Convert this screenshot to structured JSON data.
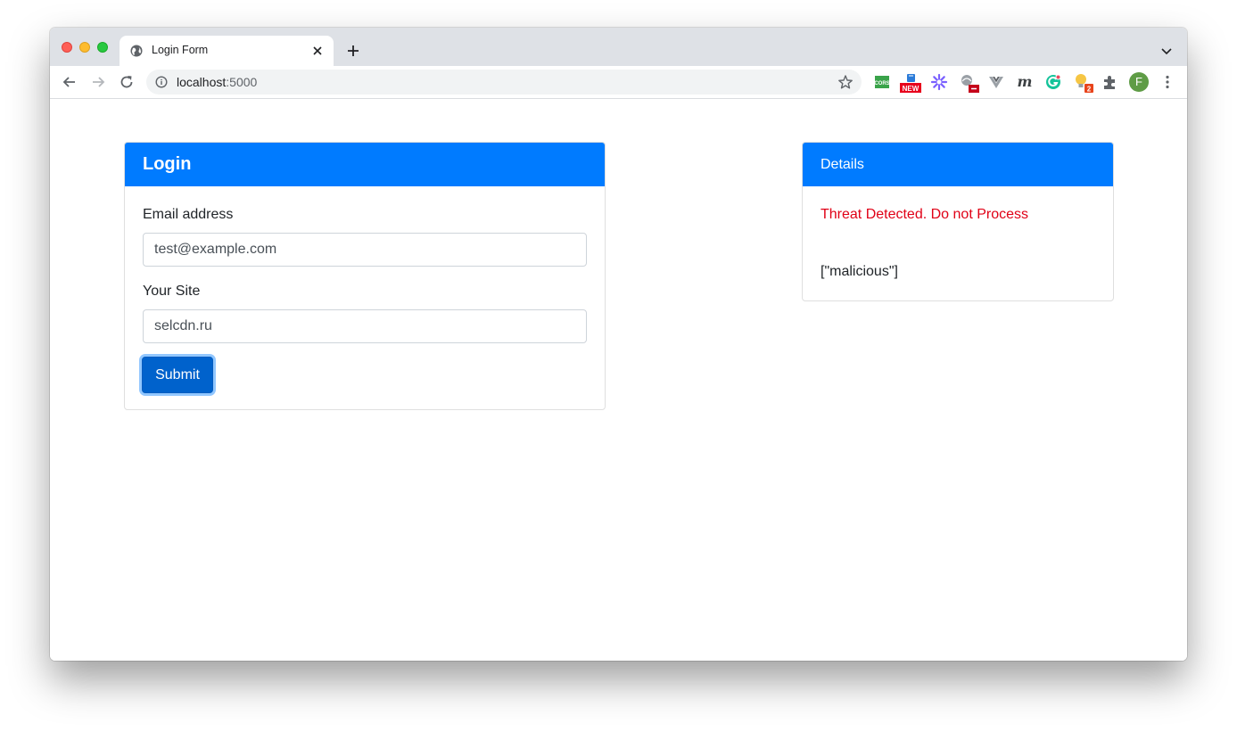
{
  "browser": {
    "tab_title": "Login Form",
    "url_host": "localhost",
    "url_port": ":5000",
    "extensions": [
      "cors-extension-icon",
      "new-badge-extension-icon",
      "asterisk-extension-icon",
      "weather-extension-icon",
      "vue-devtools-icon",
      "m-extension-icon",
      "grammarly-icon",
      "lightbulb-extension-icon",
      "puzzle-icon"
    ],
    "ext_labels": {
      "cors": "CORS",
      "new": "NEW",
      "m": "m",
      "bulb_count": "2"
    },
    "profile_initial": "F",
    "profile_color": "#5f9c46"
  },
  "login": {
    "title": "Login",
    "email_label": "Email address",
    "email_value": "test@example.com",
    "site_label": "Your Site",
    "site_value": "selcdn.ru",
    "submit_label": "Submit"
  },
  "details": {
    "title": "Details",
    "threat_message": "Threat Detected. Do not Process",
    "result": "[\"malicious\"]"
  },
  "colors": {
    "accent": "#007bff",
    "threat": "#e00016",
    "tabstrip": "#dee1e6"
  }
}
